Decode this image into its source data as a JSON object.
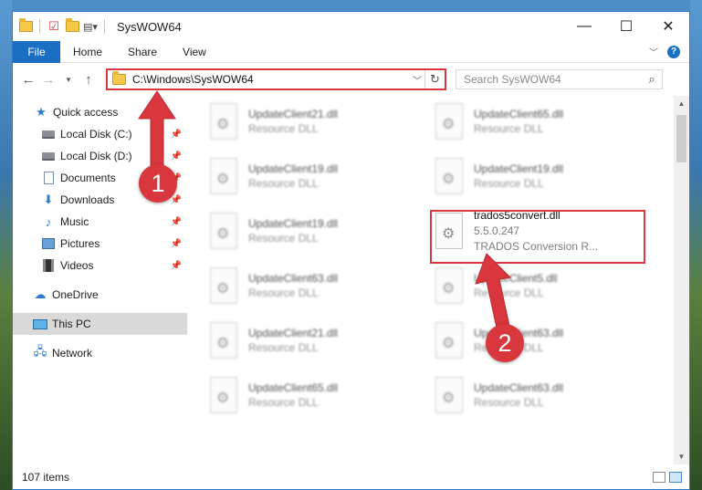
{
  "window": {
    "title": "SysWOW64",
    "minimize": "—",
    "maximize": "☐",
    "close": "✕"
  },
  "ribbon": {
    "tabs": [
      "File",
      "Home",
      "Share",
      "View"
    ],
    "help": "?"
  },
  "nav": {
    "address": "C:\\Windows\\SysWOW64",
    "search_placeholder": "Search SysWOW64"
  },
  "sidebar": {
    "items": [
      {
        "label": "Quick access",
        "icon": "star-icon"
      },
      {
        "label": "Local Disk (C:)",
        "icon": "disk-icon",
        "pinned": true
      },
      {
        "label": "Local Disk (D:)",
        "icon": "disk-icon",
        "pinned": true
      },
      {
        "label": "Documents",
        "icon": "documents-icon",
        "pinned": true
      },
      {
        "label": "Downloads",
        "icon": "downloads-icon",
        "pinned": true
      },
      {
        "label": "Music",
        "icon": "music-icon",
        "pinned": true
      },
      {
        "label": "Pictures",
        "icon": "pictures-icon",
        "pinned": true
      },
      {
        "label": "Videos",
        "icon": "videos-icon",
        "pinned": true
      },
      {
        "label": "OneDrive",
        "icon": "cloud-icon"
      },
      {
        "label": "This PC",
        "icon": "pc-icon",
        "selected": true
      },
      {
        "label": "Network",
        "icon": "network-icon"
      }
    ]
  },
  "files": [
    {
      "name": "UpdateClient21.dll",
      "sub": "Resource DLL"
    },
    {
      "name": "UpdateClient65.dll",
      "sub": "Resource DLL"
    },
    {
      "name": "UpdateClient19.dll",
      "sub": "Resource DLL"
    },
    {
      "name": "UpdateClient19.dll",
      "sub": "Resource DLL"
    },
    {
      "name": "UpdateClient19.dll",
      "sub": "Resource DLL"
    },
    {
      "name": "trados5convert.dll",
      "version": "5.5.0.247",
      "sub": "TRADOS Conversion R..."
    },
    {
      "name": "UpdateClient63.dll",
      "sub": "Resource DLL"
    },
    {
      "name": "UpdateClient5.dll",
      "sub": "Resource DLL"
    },
    {
      "name": "UpdateClient21.dll",
      "sub": "Resource DLL"
    },
    {
      "name": "UpdateClient63.dll",
      "sub": "Resource DLL"
    },
    {
      "name": "UpdateClient65.dll",
      "sub": "Resource DLL"
    },
    {
      "name": "UpdateClient63.dll",
      "sub": "Resource DLL"
    }
  ],
  "status": {
    "items": "107 items"
  },
  "annotations": {
    "step1": "1",
    "step2": "2",
    "color": "#d9363e"
  }
}
